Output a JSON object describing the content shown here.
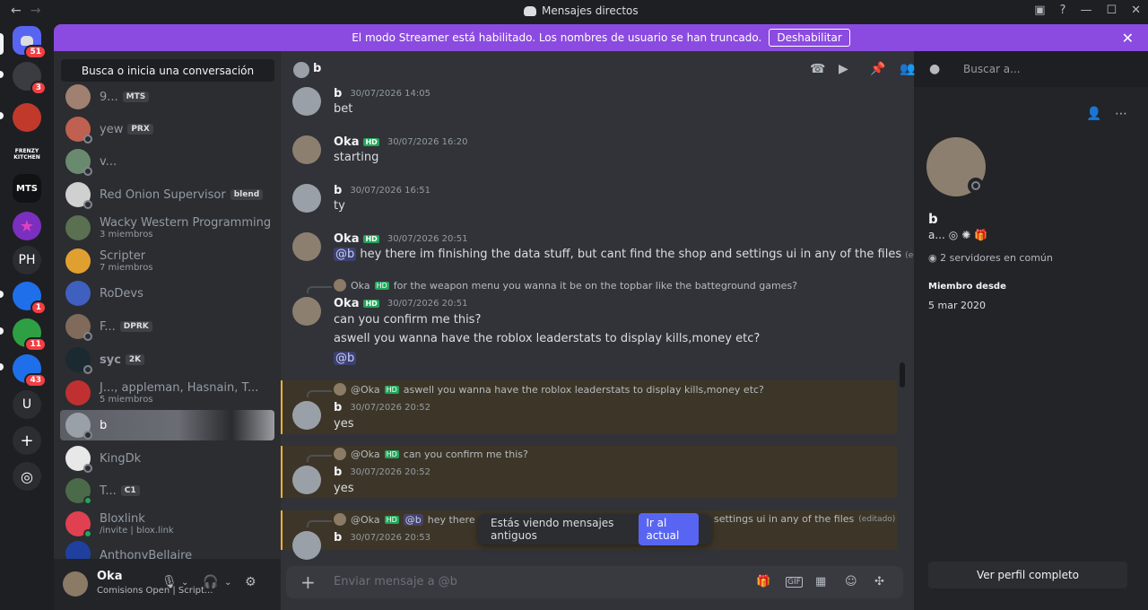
{
  "window": {
    "title": "Mensajes directos",
    "back": "←",
    "forward": "→"
  },
  "streamer": {
    "message": "El modo Streamer está habilitado. Los nombres de usuario se han truncado.",
    "button": "Deshabilitar"
  },
  "guilds": [
    {
      "label": "",
      "badge": "51",
      "color": "#5865f2"
    },
    {
      "label": "",
      "badge": "3",
      "color": "#3a3c42"
    },
    {
      "label": "",
      "badge": "",
      "color": "#c0392b"
    },
    {
      "label": "FRENZY KITCHEN",
      "badge": "",
      "color": "#1e1f22"
    },
    {
      "label": "MTS",
      "badge": "",
      "color": "#111214"
    },
    {
      "label": "★",
      "badge": "",
      "color": "#7b2fbf"
    },
    {
      "label": "PH",
      "badge": "",
      "color": "#2b2d31"
    },
    {
      "label": "",
      "badge": "1",
      "color": "#1f6feb"
    },
    {
      "label": "",
      "badge": "11",
      "color": "#2ea043"
    },
    {
      "label": "",
      "badge": "43",
      "color": "#1f6feb"
    },
    {
      "label": "U",
      "badge": "",
      "color": "#2b2d31"
    },
    {
      "label": "+",
      "badge": "",
      "color": "#2b2d31"
    },
    {
      "label": "◎",
      "badge": "",
      "color": "#2b2d31"
    }
  ],
  "dm_search": "Busca o inicia una conversación",
  "dms": [
    {
      "name": "9...",
      "tag": "MTS",
      "sub": "",
      "color": "#a08070"
    },
    {
      "name": "yew",
      "tag": "PRX",
      "sub": "",
      "color": "#c06050"
    },
    {
      "name": "v...",
      "tag": "",
      "sub": "",
      "color": "#6a8a70"
    },
    {
      "name": "Red Onion Supervisor",
      "tag": "blend",
      "sub": "",
      "color": "#d0d0d0"
    },
    {
      "name": "Wacky Western Programming",
      "tag": "",
      "sub": "3 miembros",
      "color": "#5a7050"
    },
    {
      "name": "Scripter",
      "tag": "",
      "sub": "7 miembros",
      "color": "#e0a030"
    },
    {
      "name": "RoDevs",
      "tag": "",
      "sub": "",
      "color": "#4060c0"
    },
    {
      "name": "F...",
      "tag": "DPRK",
      "sub": "",
      "color": "#806a5a"
    },
    {
      "name": "syc",
      "tag": "2K",
      "sub": "",
      "color": "#1a2a30"
    },
    {
      "name": "J..., appleman, Hasnain, T...",
      "tag": "",
      "sub": "5 miembros",
      "color": "#c03030"
    },
    {
      "name": "b",
      "tag": "",
      "sub": "",
      "color": "#9aa0a8"
    },
    {
      "name": "KingDk",
      "tag": "",
      "sub": "",
      "color": "#e8e8e8"
    },
    {
      "name": "T...",
      "tag": "C1",
      "sub": "",
      "color": "#4a6a4a"
    },
    {
      "name": "Bloxlink",
      "tag": "",
      "sub": "/invite | blox.link",
      "color": "#e04050"
    },
    {
      "name": "AnthonyBellaire",
      "tag": "",
      "sub": "",
      "color": "#2040a0"
    }
  ],
  "user": {
    "name": "Oka",
    "status": "Comisions Open | Script..."
  },
  "chat": {
    "recipient": "b",
    "search_placeholder": "Buscar a...",
    "composer_placeholder": "Enviar mensaje a @b",
    "toast_text": "Estás viendo mensajes antiguos",
    "toast_button": "Ir al actual",
    "messages": [
      {
        "author": "b",
        "time": "30/07/2026 14:05",
        "text": "bet"
      },
      {
        "author": "Oka",
        "tag": "HD",
        "time": "30/07/2026 16:20",
        "text": "starting"
      },
      {
        "author": "b",
        "time": "30/07/2026 16:51",
        "text": "ty"
      },
      {
        "author": "Oka",
        "tag": "HD",
        "time": "30/07/2026 20:51",
        "mention": "@b",
        "text": "hey there im finishing the data stuff, but cant find the shop and settings ui in any of the files",
        "edited": "(editado)"
      },
      {
        "reply_author": "Oka",
        "reply_tag": "HD",
        "reply_text": "for the weapon menu you wanna it be on the topbar like the batteground games?",
        "author": "Oka",
        "tag": "HD",
        "time": "30/07/2026 20:51",
        "text": "can you confirm me this?",
        "text2": "aswell you wanna have the roblox leaderstats to display kills,money etc?",
        "mention": "@b"
      },
      {
        "reply_author": "@Oka",
        "reply_tag": "HD",
        "reply_text": "aswell you wanna have the roblox leaderstats to display kills,money etc?",
        "author": "b",
        "time": "30/07/2026 20:52",
        "text": "yes"
      },
      {
        "reply_author": "@Oka",
        "reply_tag": "HD",
        "reply_text": "can you confirm me this?",
        "author": "b",
        "time": "30/07/2026 20:52",
        "text": "yes"
      },
      {
        "reply_author": "@Oka",
        "reply_tag": "HD",
        "reply_mention": "@b",
        "reply_text": "hey there",
        "reply_tail": "settings ui in any of the files",
        "reply_edited": "(editado)",
        "author": "b",
        "time": "30/07/2026 20:53"
      }
    ]
  },
  "profile": {
    "name": "b",
    "short": "a...",
    "mutual": "2 servidores en común",
    "member_since_label": "Miembro desde",
    "member_since": "5 mar 2020",
    "full_button": "Ver perfil completo"
  },
  "colors": {
    "accent": "#5865f2",
    "streamer": "#8b4be0",
    "hd": "#23a55a",
    "highlight": "#f0b232"
  }
}
